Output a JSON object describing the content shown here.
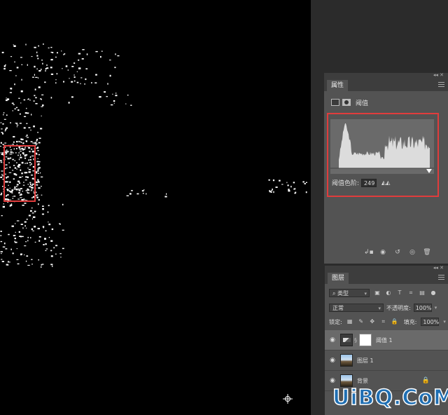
{
  "properties_panel": {
    "tab": "属性",
    "title": "阈值",
    "threshold_label": "阈值色阶:",
    "threshold_value": "249",
    "icons": [
      "adjustment-layer-icon",
      "mask-icon",
      "clip-to-layer-icon",
      "view-previous-state-icon",
      "reset-icon",
      "visibility-icon",
      "delete-icon"
    ]
  },
  "layers_panel": {
    "tab": "图层",
    "filter_kind": "类型",
    "blend_mode": "正常",
    "opacity_label": "不透明度:",
    "opacity_value": "100%",
    "lock_label": "锁定:",
    "fill_label": "填充:",
    "fill_value": "100%",
    "layers": [
      {
        "name": "阈值 1",
        "type": "adjustment",
        "selected": true
      },
      {
        "name": "图层 1",
        "type": "image",
        "selected": false
      },
      {
        "name": "背景",
        "type": "image",
        "selected": false,
        "locked": true
      }
    ]
  },
  "watermark": "UiBQ.CoM",
  "colors": {
    "highlight_box": "#e03c3c",
    "panel_bg": "#535353",
    "canvas_bg": "#000000"
  }
}
